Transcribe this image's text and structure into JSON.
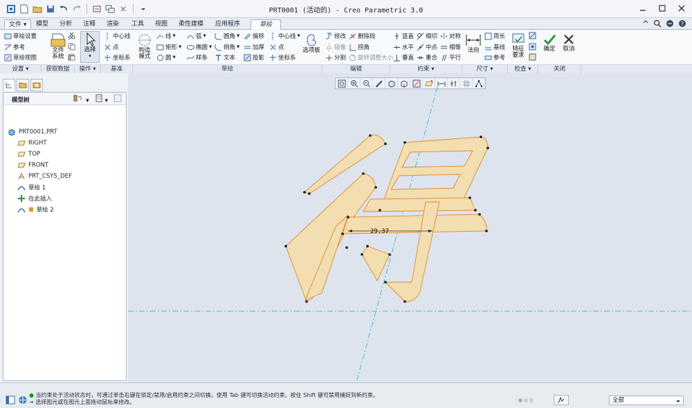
{
  "window": {
    "title": "PRT0001 (活动的) - Creo Parametric 3.0"
  },
  "tabs": [
    {
      "label": "文件"
    },
    {
      "label": "模型"
    },
    {
      "label": "分析"
    },
    {
      "label": "注释"
    },
    {
      "label": "渲染"
    },
    {
      "label": "工具"
    },
    {
      "label": "视图"
    },
    {
      "label": "柔性建模"
    },
    {
      "label": "应用程序"
    },
    {
      "label": "草绘"
    }
  ],
  "ribbon": {
    "setup": {
      "items": [
        "草绘设置",
        "参考",
        "草绘视图"
      ],
      "label": "设置"
    },
    "data": {
      "file_system": "文件\n系统",
      "label": "获取数据"
    },
    "operations": {
      "select": "选择",
      "label": "操作"
    },
    "datum": {
      "items": [
        "中心线",
        "点",
        "坐标系"
      ],
      "label": "基准"
    },
    "sketch": {
      "construct": "构造\n模式",
      "col1": [
        "线",
        "矩形",
        "圆"
      ],
      "col2": [
        "弧",
        "椭圆",
        "样条"
      ],
      "col3": [
        "圆角",
        "倒角",
        "文本"
      ],
      "col4": [
        "偏移",
        "加厚",
        "投影"
      ],
      "col5": [
        "中心线",
        "点",
        "坐标系"
      ],
      "palette": "选项板",
      "label": "草绘"
    },
    "edit": {
      "col1": [
        "修改",
        "镜像",
        "分割"
      ],
      "col2": [
        "删除段",
        "拐角",
        "旋转调整大小"
      ],
      "label": "编辑"
    },
    "constrain": {
      "col1": [
        "竖直",
        "水平",
        "垂直"
      ],
      "col2": [
        "相切",
        "中点",
        "重合"
      ],
      "col3": [
        "对称",
        "相等",
        "平行"
      ],
      "label": "约束"
    },
    "dimension": {
      "normal": "法向",
      "col": [
        "周长",
        "基线",
        "参考"
      ],
      "label": "尺寸"
    },
    "inspect": {
      "feature_req": "特征\n要求",
      "label": "检查"
    },
    "close": {
      "ok": "确定",
      "cancel": "取消",
      "label": "关闭"
    }
  },
  "model_tree": {
    "header": "模型树",
    "nodes": [
      {
        "label": "PRT0001.PRT",
        "icon": "part-icon"
      },
      {
        "label": "RIGHT",
        "icon": "datum-plane-icon"
      },
      {
        "label": "TOP",
        "icon": "datum-plane-icon"
      },
      {
        "label": "FRONT",
        "icon": "datum-plane-icon"
      },
      {
        "label": "PRT_CSYS_DEF",
        "icon": "csys-icon"
      },
      {
        "label": "草绘 1",
        "icon": "sketch-icon"
      },
      {
        "label": "在此插入",
        "icon": "insert-here-icon"
      },
      {
        "label": "草绘 2",
        "icon": "sketch-icon"
      }
    ]
  },
  "canvas": {
    "dimension": "29.37"
  },
  "status": {
    "messages": [
      "当约束处于活动状态时，可通过单击右键在锁定/禁用/启用约束之间切换。使用 Tab 键可切换活动约束。按住 Shift 键可禁用捕捉到新约束。",
      "选择图元或在图元上面拖动鼠标来修改。"
    ],
    "filter": "全部"
  },
  "colors": {
    "glyph_fill": "#f2deb0",
    "glyph_stroke": "#e08a2a",
    "centerline": "#3cc4c8"
  }
}
